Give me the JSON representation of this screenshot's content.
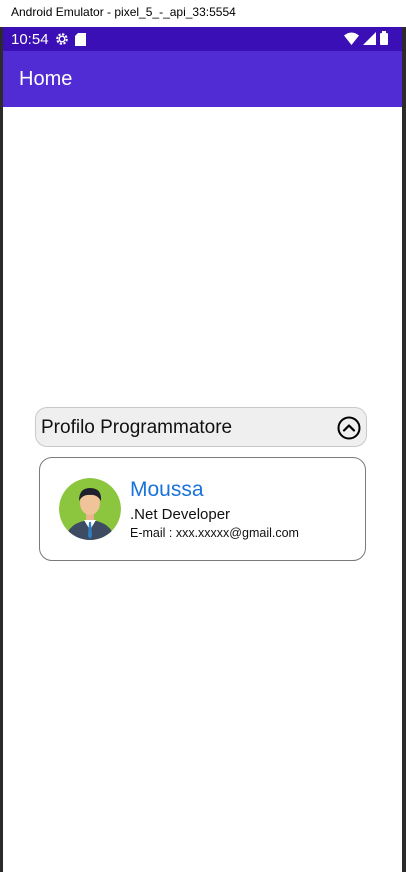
{
  "window": {
    "title": "Android Emulator - pixel_5_-_api_33:5554"
  },
  "status_bar": {
    "time": "10:54",
    "left_icons": [
      "gear-icon",
      "sd-card-icon"
    ],
    "right_icons": [
      "wifi-icon",
      "signal-icon",
      "battery-icon"
    ]
  },
  "app_bar": {
    "title": "Home"
  },
  "expander": {
    "title": "Profilo Programmatore",
    "expanded": true,
    "icon": "chevron-up-icon"
  },
  "profile": {
    "name": "Moussa",
    "role": ".Net Developer",
    "email": "E-mail : xxx.xxxxx@gmail.com"
  },
  "colors": {
    "status_bar": "#3a0fb5",
    "app_bar": "#512bd4",
    "name_text": "#1a73d9",
    "avatar_background": "#8cc63f"
  }
}
